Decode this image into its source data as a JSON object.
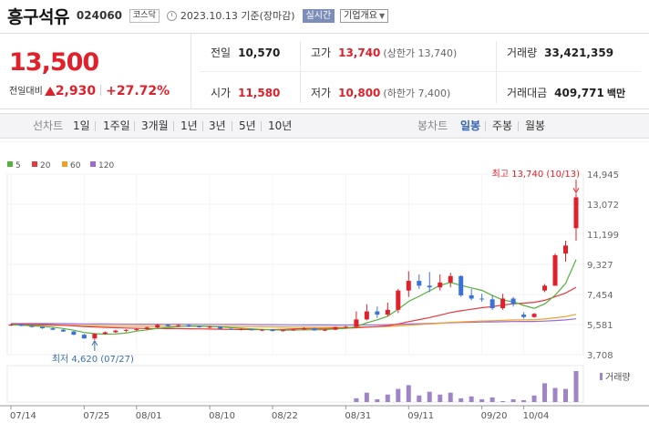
{
  "header": {
    "name": "흥구석유",
    "code": "024060",
    "market": "코스닥",
    "date": "2023.10.13 기준(장마감)",
    "live": "실시간",
    "info": "기업개요"
  },
  "summary": {
    "price": "13,500",
    "change_label": "전일대비",
    "change": "2,930",
    "change_pct": "+27.72%",
    "prev_label": "전일",
    "prev": "10,570",
    "high_label": "고가",
    "high": "13,740",
    "upper_limit": "(상한가 13,740)",
    "volume_label": "거래량",
    "volume": "33,421,359",
    "open_label": "시가",
    "open": "11,580",
    "low_label": "저가",
    "low": "10,800",
    "lower_limit": "(하한가 7,400)",
    "amount_label": "거래대금",
    "amount": "409,771",
    "amount_unit": "백만"
  },
  "tabs": {
    "line_label": "선차트",
    "periods": [
      "1일",
      "1주일",
      "3개월",
      "1년",
      "3년",
      "5년",
      "10년"
    ],
    "candle_label": "봉차트",
    "candles": [
      "일봉",
      "주봉",
      "월봉"
    ],
    "active_candle": "일봉"
  },
  "colors": {
    "up": "#e0202b",
    "down": "#3a72d6",
    "ma5": "#53b23c",
    "ma20": "#e8383d",
    "ma60": "#f0a027",
    "ma120": "#9a6bd0",
    "volume": "#9f85c8"
  },
  "chart_data": {
    "type": "candlestick",
    "legend": [
      "5",
      "20",
      "60",
      "120"
    ],
    "y_ticks": [
      14945,
      13072,
      11199,
      9327,
      7454,
      5581,
      3708
    ],
    "ylim": [
      3708,
      14945
    ],
    "x_ticks": [
      {
        "label": "07/14",
        "index": 0
      },
      {
        "label": "07/25",
        "index": 7
      },
      {
        "label": "08/01",
        "index": 12
      },
      {
        "label": "08/10",
        "index": 19
      },
      {
        "label": "08/22",
        "index": 25
      },
      {
        "label": "08/31",
        "index": 32
      },
      {
        "label": "09/11",
        "index": 38
      },
      {
        "label": "09/20",
        "index": 45
      },
      {
        "label": "10/04",
        "index": 49
      }
    ],
    "high_annotation": "최고 13,740 (10/13)",
    "low_annotation": "최저 4,620 (07/27)",
    "volume_label": "거래량",
    "candles": [
      {
        "o": 5560,
        "h": 5620,
        "l": 5500,
        "c": 5580
      },
      {
        "o": 5580,
        "h": 5620,
        "l": 5480,
        "c": 5500
      },
      {
        "o": 5500,
        "h": 5560,
        "l": 5400,
        "c": 5430
      },
      {
        "o": 5430,
        "h": 5480,
        "l": 5320,
        "c": 5350
      },
      {
        "o": 5350,
        "h": 5400,
        "l": 5230,
        "c": 5260
      },
      {
        "o": 5260,
        "h": 5300,
        "l": 5120,
        "c": 5150
      },
      {
        "o": 5150,
        "h": 5180,
        "l": 4920,
        "c": 4950
      },
      {
        "o": 4950,
        "h": 5000,
        "l": 4700,
        "c": 4720
      },
      {
        "o": 4720,
        "h": 5050,
        "l": 4620,
        "c": 5000
      },
      {
        "o": 5000,
        "h": 5150,
        "l": 4950,
        "c": 5100
      },
      {
        "o": 5100,
        "h": 5250,
        "l": 5050,
        "c": 5200
      },
      {
        "o": 5200,
        "h": 5300,
        "l": 5100,
        "c": 5250
      },
      {
        "o": 5250,
        "h": 5350,
        "l": 5180,
        "c": 5300
      },
      {
        "o": 5300,
        "h": 5450,
        "l": 5250,
        "c": 5400
      },
      {
        "o": 5400,
        "h": 5620,
        "l": 5350,
        "c": 5560
      },
      {
        "o": 5560,
        "h": 5620,
        "l": 5450,
        "c": 5480
      },
      {
        "o": 5480,
        "h": 5600,
        "l": 5430,
        "c": 5540
      },
      {
        "o": 5540,
        "h": 5580,
        "l": 5420,
        "c": 5460
      },
      {
        "o": 5460,
        "h": 5520,
        "l": 5400,
        "c": 5420
      },
      {
        "o": 5420,
        "h": 5500,
        "l": 5350,
        "c": 5450
      },
      {
        "o": 5450,
        "h": 5480,
        "l": 5300,
        "c": 5320
      },
      {
        "o": 5320,
        "h": 5380,
        "l": 5250,
        "c": 5280
      },
      {
        "o": 5280,
        "h": 5350,
        "l": 5220,
        "c": 5300
      },
      {
        "o": 5300,
        "h": 5320,
        "l": 5200,
        "c": 5230
      },
      {
        "o": 5230,
        "h": 5300,
        "l": 5180,
        "c": 5260
      },
      {
        "o": 5260,
        "h": 5300,
        "l": 5150,
        "c": 5180
      },
      {
        "o": 5180,
        "h": 5260,
        "l": 5150,
        "c": 5230
      },
      {
        "o": 5230,
        "h": 5320,
        "l": 5200,
        "c": 5280
      },
      {
        "o": 5280,
        "h": 5400,
        "l": 5230,
        "c": 5350
      },
      {
        "o": 5350,
        "h": 5380,
        "l": 5200,
        "c": 5220
      },
      {
        "o": 5220,
        "h": 5300,
        "l": 5180,
        "c": 5260
      },
      {
        "o": 5260,
        "h": 5450,
        "l": 5250,
        "c": 5420
      },
      {
        "o": 5420,
        "h": 5500,
        "l": 5380,
        "c": 5450
      },
      {
        "o": 5450,
        "h": 6400,
        "l": 5400,
        "c": 5900
      },
      {
        "o": 5900,
        "h": 6850,
        "l": 5850,
        "c": 6400
      },
      {
        "o": 6400,
        "h": 6700,
        "l": 6000,
        "c": 6200
      },
      {
        "o": 6200,
        "h": 6950,
        "l": 6100,
        "c": 6500
      },
      {
        "o": 6500,
        "h": 7800,
        "l": 6300,
        "c": 7700
      },
      {
        "o": 7700,
        "h": 8900,
        "l": 7300,
        "c": 8300
      },
      {
        "o": 8300,
        "h": 8700,
        "l": 7800,
        "c": 8000
      },
      {
        "o": 8000,
        "h": 8850,
        "l": 7600,
        "c": 7900
      },
      {
        "o": 7900,
        "h": 8700,
        "l": 7700,
        "c": 8200
      },
      {
        "o": 8200,
        "h": 8800,
        "l": 7900,
        "c": 8600
      },
      {
        "o": 8600,
        "h": 8650,
        "l": 7300,
        "c": 7400
      },
      {
        "o": 7400,
        "h": 7800,
        "l": 7100,
        "c": 7200
      },
      {
        "o": 7200,
        "h": 7500,
        "l": 7000,
        "c": 7150
      },
      {
        "o": 7150,
        "h": 7400,
        "l": 6500,
        "c": 6600
      },
      {
        "o": 6600,
        "h": 7500,
        "l": 6500,
        "c": 7200
      },
      {
        "o": 7200,
        "h": 7300,
        "l": 6700,
        "c": 6850
      },
      {
        "o": 6200,
        "h": 6350,
        "l": 5950,
        "c": 6050
      },
      {
        "o": 6050,
        "h": 6300,
        "l": 6000,
        "c": 6250
      },
      {
        "o": 7700,
        "h": 8100,
        "l": 7600,
        "c": 8000
      },
      {
        "o": 8000,
        "h": 10000,
        "l": 8000,
        "c": 9900
      },
      {
        "o": 10000,
        "h": 10800,
        "l": 9500,
        "c": 10500
      },
      {
        "o": 11580,
        "h": 13740,
        "l": 10800,
        "c": 13500
      }
    ],
    "volume": [
      0,
      0,
      0,
      0,
      0,
      0,
      0,
      0,
      0,
      0,
      0,
      0,
      0,
      0,
      0,
      0,
      0,
      0,
      0,
      0,
      0,
      0,
      0,
      0,
      0,
      0,
      0,
      0,
      0,
      0,
      0,
      0,
      0,
      4,
      10,
      3,
      8,
      14,
      18,
      7,
      11,
      8,
      10,
      4,
      6,
      3,
      5,
      1,
      3,
      2,
      7,
      20,
      15,
      14,
      33
    ]
  }
}
